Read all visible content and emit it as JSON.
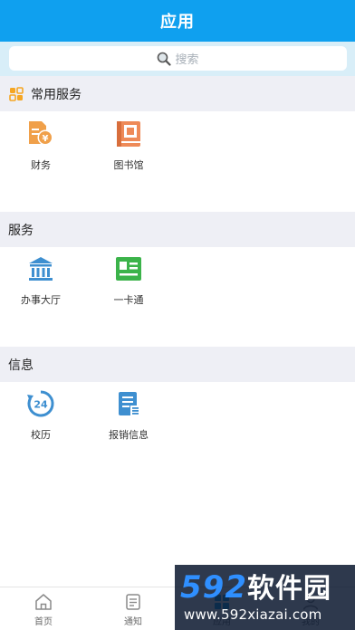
{
  "header": {
    "title": "应用"
  },
  "search": {
    "placeholder": "搜索"
  },
  "sections": [
    {
      "title": "常用服务",
      "items": [
        {
          "label": "财务",
          "icon": "finance-icon"
        },
        {
          "label": "图书馆",
          "icon": "library-icon"
        }
      ]
    },
    {
      "title": "服务",
      "items": [
        {
          "label": "办事大厅",
          "icon": "service-hall-icon"
        },
        {
          "label": "一卡通",
          "icon": "campus-card-icon"
        }
      ]
    },
    {
      "title": "信息",
      "items": [
        {
          "label": "校历",
          "icon": "calendar-24-icon"
        },
        {
          "label": "报销信息",
          "icon": "reimbursement-icon"
        }
      ]
    }
  ],
  "tabbar": {
    "items": [
      {
        "label": "首页",
        "icon": "home-icon"
      },
      {
        "label": "通知",
        "icon": "notification-icon"
      },
      {
        "label": "应用",
        "icon": "apps-icon"
      },
      {
        "label": "我的",
        "icon": "profile-icon"
      }
    ]
  },
  "watermark": {
    "logo_number": "592",
    "logo_text": "软件园",
    "url": "www.592xiazai.com"
  },
  "colors": {
    "header_bg": "#0fa0ef",
    "search_band": "#d8eef8",
    "section_bg": "#eeeff5",
    "icon_orange": "#f0a04a",
    "icon_blue": "#3e8fd0",
    "icon_green": "#3bb34a"
  }
}
